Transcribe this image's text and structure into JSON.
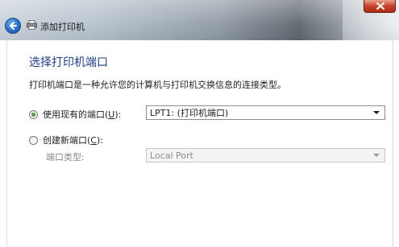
{
  "window": {
    "title": "添加打印机"
  },
  "page": {
    "heading": "选择打印机端口",
    "description": "打印机端口是一种允许您的计算机与打印机交换信息的连接类型。"
  },
  "options": {
    "existing_port": {
      "label": "使用现有的端口(",
      "key": "U",
      "suffix": "):",
      "selected": true,
      "value": "LPT1: (打印机端口)"
    },
    "new_port": {
      "label": "创建新端口(",
      "key": "C",
      "suffix": "):",
      "selected": false
    },
    "port_type": {
      "label": "端口类型:",
      "value": "Local Port"
    }
  },
  "icons": {
    "back": "back-arrow-icon",
    "printer": "printer-icon",
    "close": "close-icon"
  },
  "colors": {
    "heading": "#1d3f8c",
    "back_button": "#2a6fc4"
  }
}
